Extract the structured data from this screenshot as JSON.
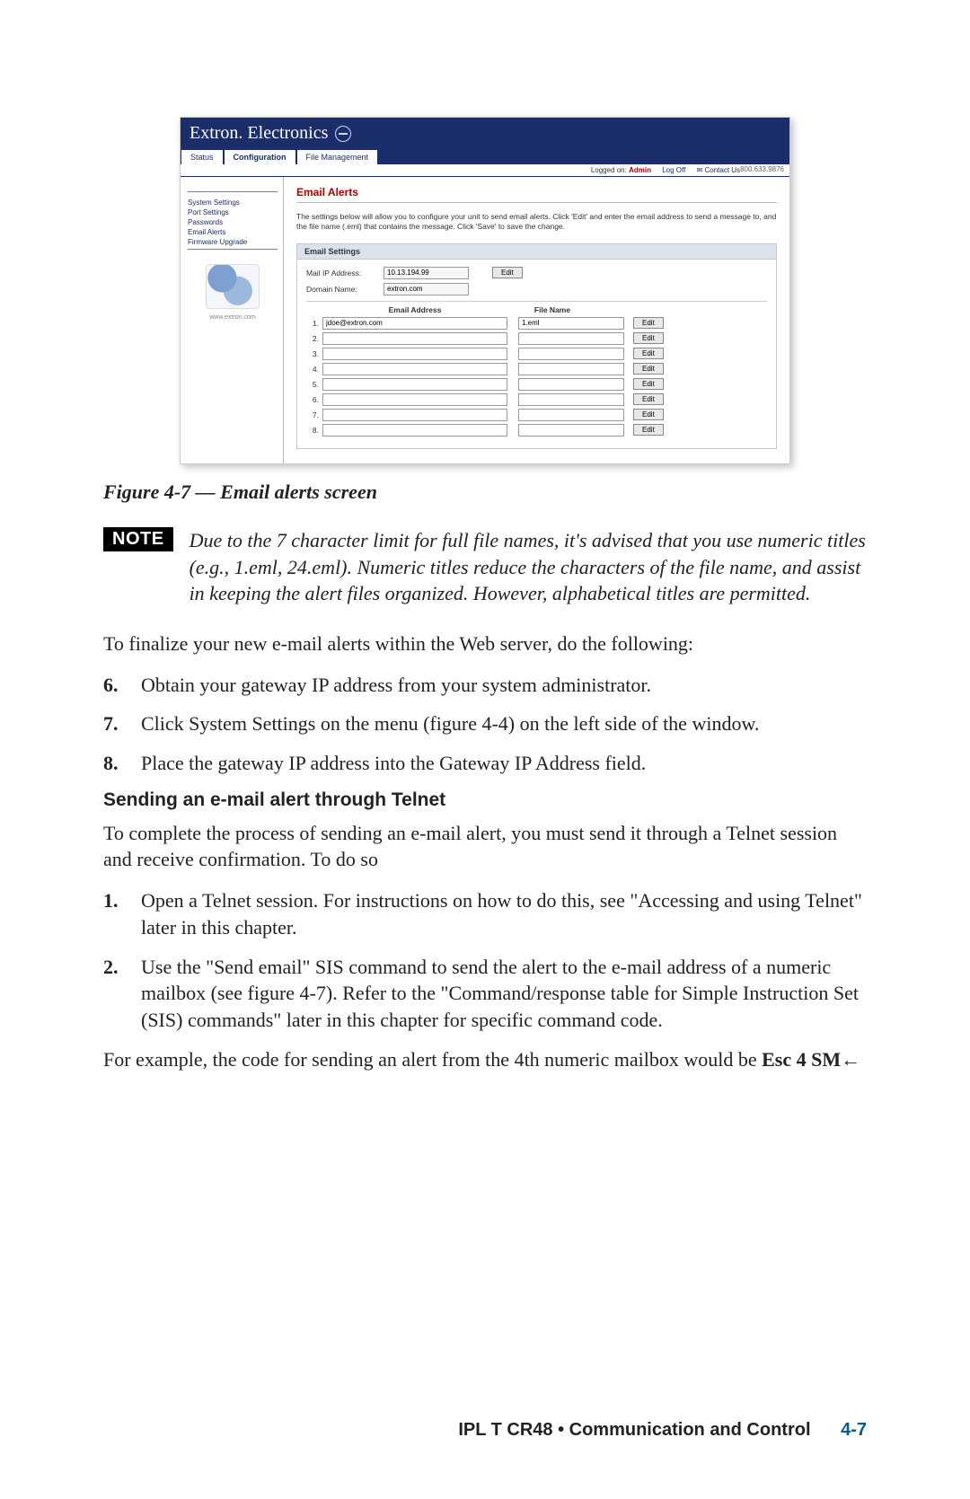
{
  "screenshot": {
    "brand": "Extron. Electronics",
    "tabs": [
      "Status",
      "Configuration",
      "File Management"
    ],
    "phone": "800.633.9876",
    "logged_on_label": "Logged on:",
    "logged_on_user": "Admin",
    "logoff": "Log Off",
    "contact": "Contact Us",
    "sidebar": {
      "items": [
        "System Settings",
        "Port Settings",
        "Passwords",
        "Email Alerts",
        "Firmware Upgrade"
      ],
      "url": "www.extron.com"
    },
    "main": {
      "title": "Email Alerts",
      "desc": "The settings below will allow you to configure your unit to send email alerts. Click 'Edit' and enter the email address to send a message to, and the file name (.eml) that contains the message. Click 'Save' to save the change.",
      "panel_header": "Email Settings",
      "mail_ip_label": "Mail IP Address:",
      "mail_ip_value": "10.13.194.99",
      "domain_label": "Domain Name:",
      "domain_value": "extron.com",
      "edit_btn": "Edit",
      "col_email": "Email Address",
      "col_file": "File Name",
      "rows": [
        {
          "n": "1.",
          "email": "jdoe@extron.com",
          "file": "1.eml"
        },
        {
          "n": "2.",
          "email": "",
          "file": ""
        },
        {
          "n": "3.",
          "email": "",
          "file": ""
        },
        {
          "n": "4.",
          "email": "",
          "file": ""
        },
        {
          "n": "5.",
          "email": "",
          "file": ""
        },
        {
          "n": "6.",
          "email": "",
          "file": ""
        },
        {
          "n": "7.",
          "email": "",
          "file": ""
        },
        {
          "n": "8.",
          "email": "",
          "file": ""
        }
      ]
    }
  },
  "caption": "Figure 4-7 — Email alerts screen",
  "note_label": "NOTE",
  "note_text": "Due to the 7 character limit for full file names, it's advised that you use numeric titles (e.g., 1.eml, 24.eml). Numeric titles reduce the characters of the file name, and assist in keeping the alert files organized.  However, alphabetical titles are permitted.",
  "para_intro": "To finalize your new e-mail alerts within the Web server, do the following:",
  "steps_a": [
    {
      "n": "6.",
      "t": "Obtain your gateway IP address from your system administrator."
    },
    {
      "n": "7.",
      "t": "Click System Settings on the menu (figure 4-4) on the left side of the window."
    },
    {
      "n": "8.",
      "t": "Place the gateway IP address into the Gateway IP Address field."
    }
  ],
  "subhead": "Sending an e-mail alert through Telnet",
  "para_telnet": "To complete the process of sending an e-mail alert, you must send it through a Telnet session and receive confirmation.  To do so",
  "steps_b": [
    {
      "n": "1.",
      "t": "Open a Telnet session.  For instructions on how to do this, see \"Accessing and using Telnet\" later in this chapter."
    },
    {
      "n": "2.",
      "t": "Use the \"Send email\" SIS command to send the alert to the e-mail address of a numeric mailbox (see figure 4-7).  Refer to the \"Command/response table for Simple Instruction Set (SIS) commands\" later in this chapter for specific command code."
    }
  ],
  "example_prefix": "For example, the code for sending an alert from the 4th numeric mailbox would be ",
  "example_code": "Esc 4 SM",
  "example_arrow": "←",
  "footer_section": "IPL T CR48 • Communication and Control",
  "footer_page": "4-7"
}
